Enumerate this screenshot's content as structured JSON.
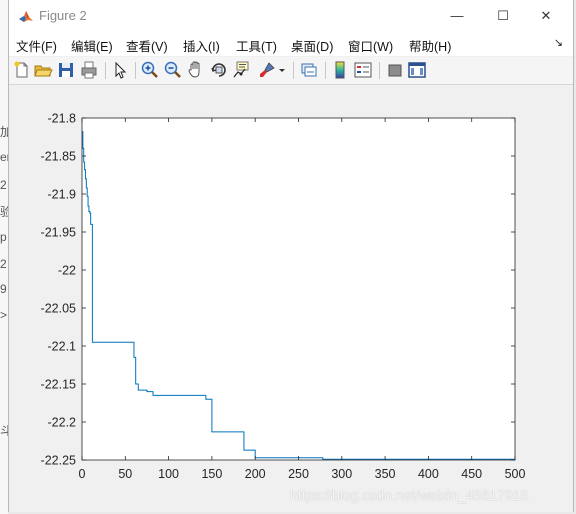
{
  "window": {
    "title": "Figure 2",
    "minimize_glyph": "—",
    "maximize_glyph": "☐",
    "close_glyph": "✕"
  },
  "menubar": {
    "items": [
      {
        "label": "文件(F)"
      },
      {
        "label": "编辑(E)"
      },
      {
        "label": "查看(V)"
      },
      {
        "label": "插入(I)"
      },
      {
        "label": "工具(T)"
      },
      {
        "label": "桌面(D)"
      },
      {
        "label": "窗口(W)"
      },
      {
        "label": "帮助(H)"
      }
    ],
    "dock_glyph": "↘"
  },
  "toolbar": {
    "icons": [
      "new-figure-icon",
      "open-file-icon",
      "save-icon",
      "print-icon",
      "pointer-icon",
      "zoom-in-icon",
      "zoom-out-icon",
      "pan-hand-icon",
      "rotate-3d-icon",
      "data-cursor-icon",
      "brush-icon",
      "brush-dropdown-icon",
      "link-plot-icon",
      "colorbar-icon",
      "legend-icon",
      "hide-plot-tools-icon",
      "show-plot-tools-icon"
    ]
  },
  "left_glimpse": [
    "加",
    "er",
    "2",
    "验",
    "p",
    "2",
    "9",
    ">",
    "斗"
  ],
  "watermark": "https://blog.csdn.net/weixin_45617915",
  "chart_data": {
    "type": "line",
    "xlim": [
      0,
      500
    ],
    "ylim": [
      -22.25,
      -21.8
    ],
    "xticks": [
      "0",
      "50",
      "100",
      "150",
      "200",
      "250",
      "300",
      "350",
      "400",
      "450",
      "500"
    ],
    "yticks": [
      "-21.8",
      "-21.85",
      "-21.9",
      "-21.95",
      "-22",
      "-22.05",
      "-22.1",
      "-22.15",
      "-22.2",
      "-22.25"
    ],
    "line_color": "#0072BD",
    "grid": false,
    "series": [
      {
        "x": [
          0,
          1,
          1,
          2,
          2,
          3,
          3,
          4,
          4,
          5,
          5,
          6,
          6,
          7,
          7,
          8,
          8,
          9,
          9,
          10,
          10,
          12,
          12,
          60,
          60,
          62,
          62,
          65,
          65,
          75,
          75,
          82,
          82,
          85,
          85,
          143,
          143,
          150,
          150,
          187,
          187,
          200,
          200,
          278,
          278,
          500
        ],
        "y": [
          -21.818,
          -21.818,
          -21.84,
          -21.84,
          -21.858,
          -21.858,
          -21.868,
          -21.868,
          -21.88,
          -21.88,
          -21.892,
          -21.892,
          -21.903,
          -21.903,
          -21.916,
          -21.916,
          -21.923,
          -21.923,
          -21.925,
          -21.925,
          -21.94,
          -21.94,
          -22.095,
          -22.095,
          -22.115,
          -22.115,
          -22.15,
          -22.15,
          -22.158,
          -22.158,
          -22.16,
          -22.16,
          -22.165,
          -22.165,
          -22.165,
          -22.165,
          -22.17,
          -22.17,
          -22.213,
          -22.213,
          -22.237,
          -22.237,
          -22.247,
          -22.247,
          -22.249,
          -22.249
        ]
      }
    ]
  }
}
